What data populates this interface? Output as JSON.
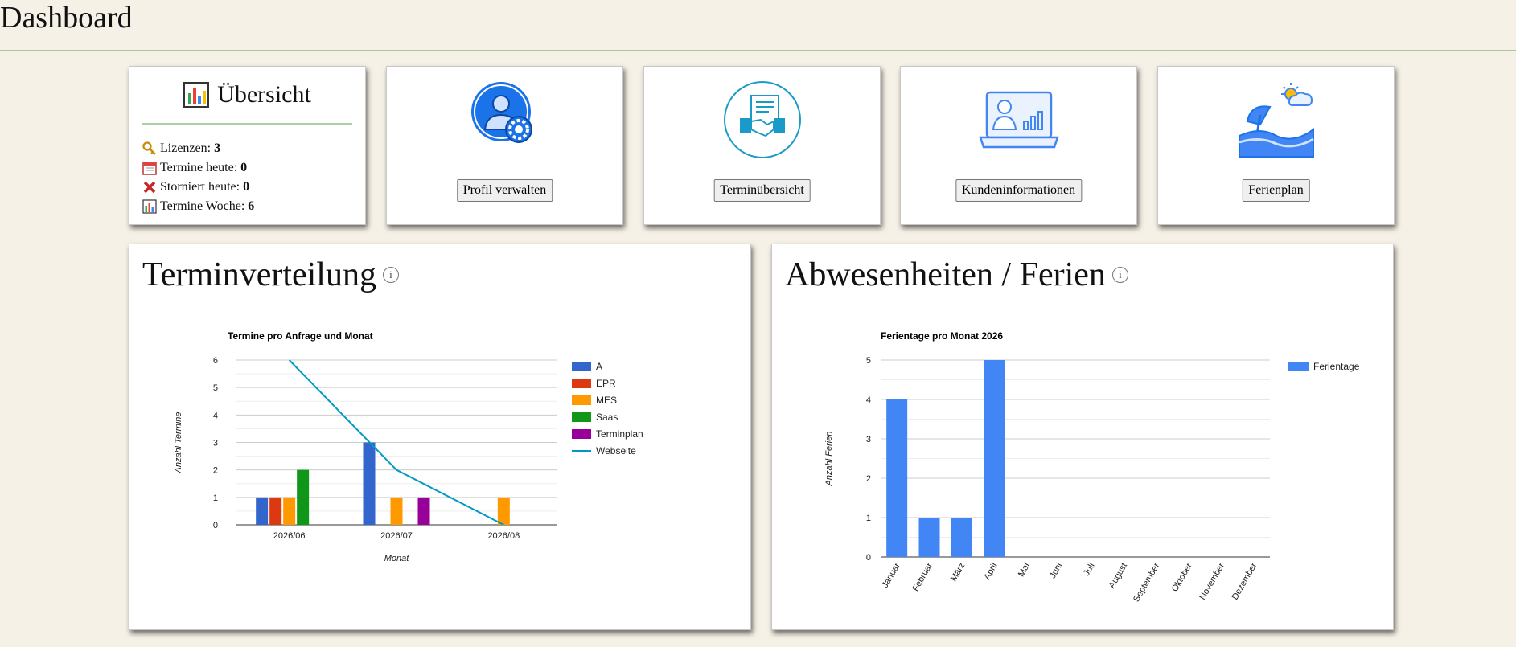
{
  "page": {
    "title": "Dashboard"
  },
  "overview": {
    "title": "Übersicht",
    "icon": "bar-chart-icon",
    "stats": [
      {
        "icon": "key-icon",
        "label": "Lizenzen:",
        "value": "3"
      },
      {
        "icon": "calendar-icon",
        "label": "Termine heute:",
        "value": "0"
      },
      {
        "icon": "cancel-x-icon",
        "label": "Storniert heute:",
        "value": "0"
      },
      {
        "icon": "bar-chart-icon",
        "label": "Termine Woche:",
        "value": "6"
      }
    ]
  },
  "tiles": [
    {
      "icon": "user-settings-icon",
      "label": "Profil verwalten"
    },
    {
      "icon": "handshake-icon",
      "label": "Terminübersicht"
    },
    {
      "icon": "customer-info-icon",
      "label": "Kundeninformationen"
    },
    {
      "icon": "beach-vacation-icon",
      "label": "Ferienplan"
    }
  ],
  "panels": {
    "termin": {
      "title": "Terminverteilung",
      "info": "i"
    },
    "ferien": {
      "title": "Abwesenheiten / Ferien",
      "info": "i"
    }
  },
  "colors": {
    "A": "#3366cc",
    "EPR": "#dc3912",
    "MES": "#ff9900",
    "Saas": "#109618",
    "Terminplan": "#990099",
    "Webseite": "#0099c6",
    "Ferientage": "#4285f4"
  },
  "chart_data": [
    {
      "type": "bar",
      "title": "Termine pro Anfrage und Monat",
      "xlabel": "Monat",
      "ylabel": "Anzahl Termine",
      "ylim": [
        0,
        6
      ],
      "yticks": [
        "0",
        "1",
        "2",
        "3",
        "4",
        "5",
        "6"
      ],
      "categories": [
        "2026/06",
        "2026/07",
        "2026/08"
      ],
      "legend_position": "right",
      "grid": true,
      "series": [
        {
          "name": "A",
          "kind": "bar",
          "values": [
            1,
            3,
            0
          ]
        },
        {
          "name": "EPR",
          "kind": "bar",
          "values": [
            1,
            0,
            0
          ]
        },
        {
          "name": "MES",
          "kind": "bar",
          "values": [
            1,
            1,
            1
          ]
        },
        {
          "name": "Saas",
          "kind": "bar",
          "values": [
            2,
            0,
            0
          ]
        },
        {
          "name": "Terminplan",
          "kind": "bar",
          "values": [
            0,
            1,
            0
          ]
        },
        {
          "name": "Webseite",
          "kind": "line",
          "values": [
            6,
            2,
            0
          ]
        }
      ]
    },
    {
      "type": "bar",
      "title": "Ferientage pro Monat 2026",
      "xlabel": "",
      "ylabel": "Anzahl Ferien",
      "ylim": [
        0,
        5
      ],
      "yticks": [
        "0",
        "1",
        "2",
        "3",
        "4",
        "5"
      ],
      "categories": [
        "Januar",
        "Februar",
        "März",
        "April",
        "Mai",
        "Juni",
        "Juli",
        "August",
        "September",
        "Oktober",
        "November",
        "Dezember"
      ],
      "legend_position": "right",
      "grid": true,
      "series": [
        {
          "name": "Ferientage",
          "values": [
            4,
            1,
            1,
            5,
            0,
            0,
            0,
            0,
            0,
            0,
            0,
            0
          ]
        }
      ]
    }
  ]
}
